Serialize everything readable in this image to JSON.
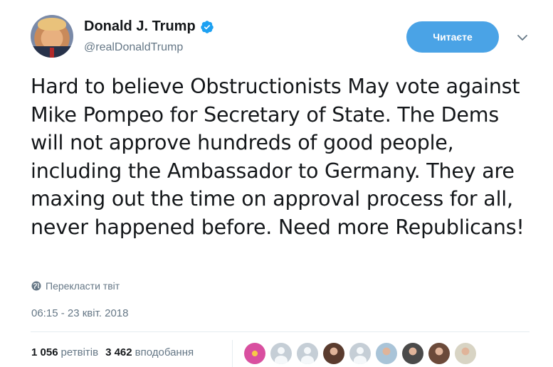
{
  "user": {
    "display_name": "Donald J. Trump",
    "handle": "@realDonaldTrump",
    "verified": true
  },
  "follow_button": {
    "label": "Читаєте"
  },
  "tweet": {
    "text": "Hard to believe Obstructionists May vote against Mike Pompeo for Secretary of State. The Dems will not approve hundreds of good people, including the Ambassador to Germany. They are maxing out the time on approval process for all, never happened before. Need more Republicans!",
    "translate_label": "Перекласти твіт",
    "timestamp": "06:15 - 23 квіт. 2018"
  },
  "stats": {
    "retweets_count": "1 056",
    "retweets_label": "ретвітів",
    "likes_count": "3 462",
    "likes_label": "вподобання"
  },
  "likers": [
    {
      "name": "liker-avatar-flower",
      "icon": "flower",
      "color": "#d94fa0"
    },
    {
      "name": "liker-avatar-default-1",
      "icon": "default-person"
    },
    {
      "name": "liker-avatar-default-2",
      "icon": "default-person"
    },
    {
      "name": "liker-avatar-photo-1",
      "icon": "photo",
      "color": "#5a3b2e"
    },
    {
      "name": "liker-avatar-default-3",
      "icon": "default-person"
    },
    {
      "name": "liker-avatar-beach",
      "icon": "photo",
      "color": "#a9c4d8"
    },
    {
      "name": "liker-avatar-statue",
      "icon": "photo",
      "color": "#4a4a4a"
    },
    {
      "name": "liker-avatar-photo-2",
      "icon": "photo",
      "color": "#6b4a3a"
    },
    {
      "name": "liker-avatar-frame",
      "icon": "photo",
      "color": "#d8d4c4"
    }
  ],
  "colors": {
    "accent": "#4aa3e6",
    "text_primary": "#14171a",
    "text_secondary": "#657786",
    "verified_badge": "#1da1f2"
  }
}
